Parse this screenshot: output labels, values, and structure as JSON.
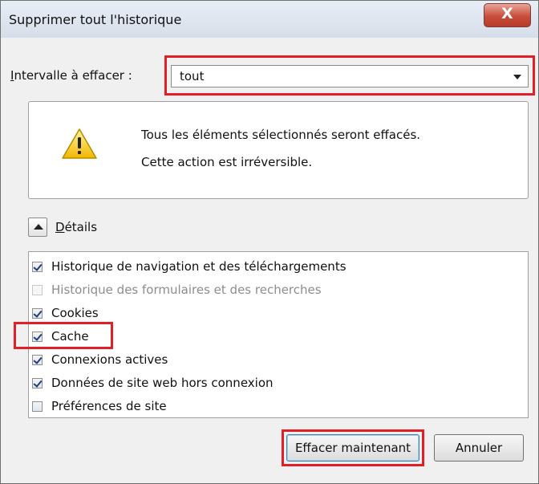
{
  "dialog": {
    "title": "Supprimer tout l'historique",
    "close_glyph": "X"
  },
  "interval": {
    "label_accel": "I",
    "label_rest": "ntervalle à effacer :",
    "selected": "tout"
  },
  "warning": {
    "line1": "Tous les éléments sélectionnés seront effacés.",
    "line2": "Cette action est irréversible.",
    "icon": "warning-icon"
  },
  "details": {
    "label_accel": "D",
    "label_rest": "étails",
    "toggle_icon": "chevron-up-icon"
  },
  "items": [
    {
      "label": "Historique de navigation et des téléchargements",
      "checked": true,
      "disabled": false
    },
    {
      "label": "Historique des formulaires et des recherches",
      "checked": false,
      "disabled": true
    },
    {
      "label": "Cookies",
      "checked": true,
      "disabled": false
    },
    {
      "label": "Cache",
      "checked": true,
      "disabled": false
    },
    {
      "label": "Connexions actives",
      "checked": true,
      "disabled": false
    },
    {
      "label": "Données de site web hors connexion",
      "checked": true,
      "disabled": false
    },
    {
      "label": "Préférences de site",
      "checked": false,
      "disabled": false
    }
  ],
  "buttons": {
    "clear_now": "Effacer maintenant",
    "cancel": "Annuler"
  },
  "colors": {
    "highlight": "#e21f26",
    "close_button": "#c74e3c",
    "warning_yellow": "#f6c700"
  }
}
